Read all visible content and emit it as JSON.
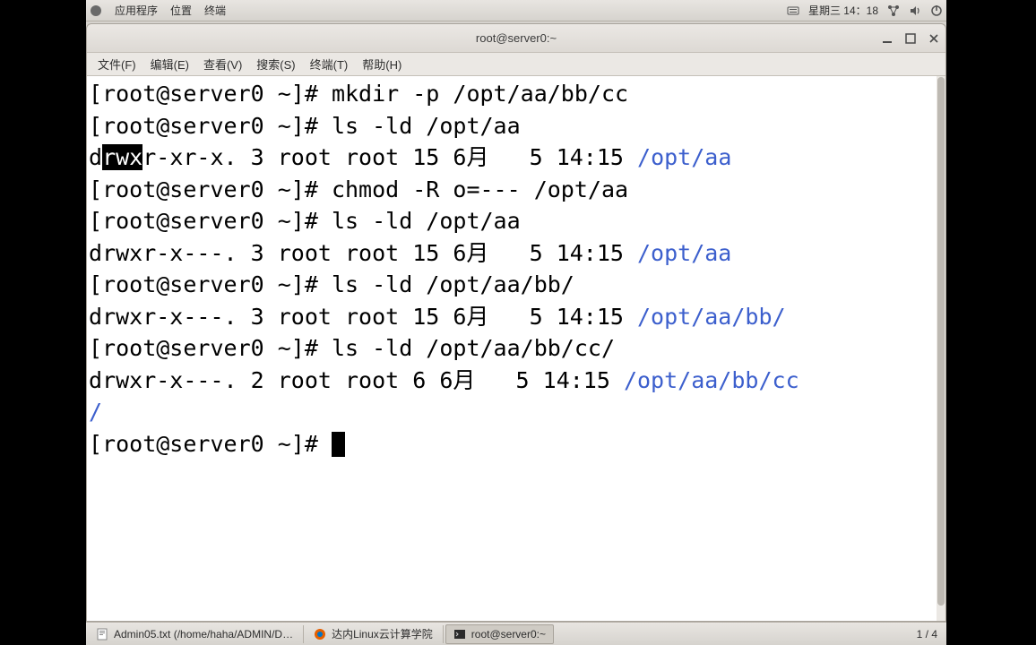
{
  "top_panel": {
    "apps": "应用程序",
    "places": "位置",
    "terminal_menu": "终端",
    "datetime": "星期三  14：18"
  },
  "window": {
    "title": "root@server0:~"
  },
  "menubar": {
    "file": "文件(F)",
    "edit": "编辑(E)",
    "view": "查看(V)",
    "search": "搜索(S)",
    "terminal": "终端(T)",
    "help": "帮助(H)"
  },
  "terminal": {
    "lines": [
      {
        "prompt": "[root@server0 ~]# ",
        "cmd": "mkdir -p /opt/aa/bb/cc"
      },
      {
        "prompt": "[root@server0 ~]# ",
        "cmd": "ls -ld /opt/aa"
      },
      {
        "out_pre": "d",
        "out_sel": "rwx",
        "out_mid": "r-xr-x. 3 root root 15 6月   5 14:15 ",
        "out_blue": "/opt/aa"
      },
      {
        "prompt": "[root@server0 ~]# ",
        "cmd": "chmod -R o=--- /opt/aa"
      },
      {
        "prompt": "[root@server0 ~]# ",
        "cmd": "ls -ld /opt/aa"
      },
      {
        "out_pre": "drwxr-x---. 3 root root 15 6月   5 14:15 ",
        "out_blue": "/opt/aa"
      },
      {
        "prompt": "[root@server0 ~]# ",
        "cmd": "ls -ld /opt/aa/bb/"
      },
      {
        "out_pre": "drwxr-x---. 3 root root 15 6月   5 14:15 ",
        "out_blue": "/opt/aa/bb/"
      },
      {
        "prompt": "[root@server0 ~]# ",
        "cmd": "ls -ld /opt/aa/bb/cc/"
      },
      {
        "out_pre": "drwxr-x---. 2 root root 6 6月   5 14:15 ",
        "out_blue": "/opt/aa/bb/cc"
      },
      {
        "out_blue": "/"
      },
      {
        "prompt": "[root@server0 ~]# ",
        "cursor": true
      }
    ]
  },
  "taskbar": {
    "items": [
      {
        "label": "Admin05.txt (/home/haha/ADMIN/D…"
      },
      {
        "label": "达内Linux云计算学院"
      },
      {
        "label": "root@server0:~",
        "active": true
      }
    ],
    "workspace": "1  /  4"
  }
}
